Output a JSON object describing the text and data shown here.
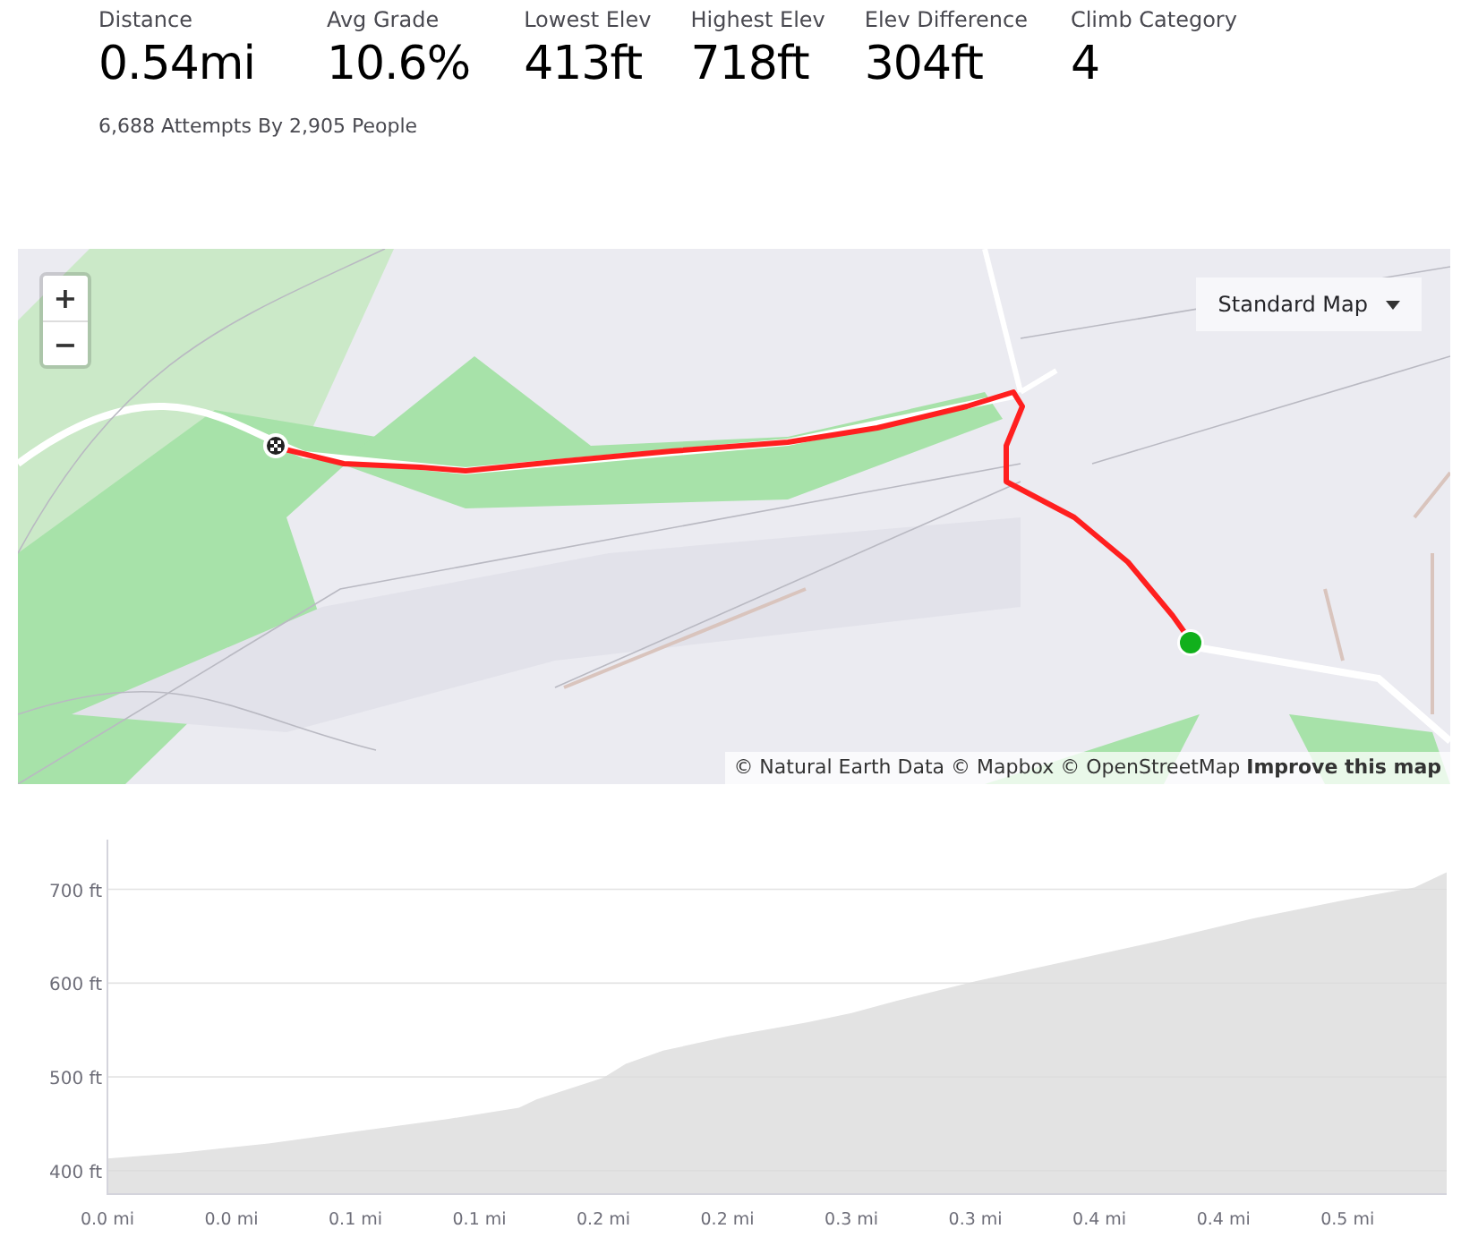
{
  "stats": [
    {
      "label": "Distance",
      "value": "0.54mi"
    },
    {
      "label": "Avg Grade",
      "value": "10.6%"
    },
    {
      "label": "Lowest Elev",
      "value": "413ft"
    },
    {
      "label": "Highest Elev",
      "value": "718ft"
    },
    {
      "label": "Elev Difference",
      "value": "304ft"
    },
    {
      "label": "Climb Category",
      "value": "4"
    }
  ],
  "attempts": "6,688 Attempts By 2,905 People",
  "map": {
    "kind": "picture",
    "zoom_in": "+",
    "zoom_out": "−",
    "style_selector": "Standard Map",
    "attribution": "© Natural Earth Data © Mapbox © OpenStreetMap",
    "attribution_link": "Improve this map"
  },
  "elevation_profile": {
    "chart_data": {
      "type": "area",
      "xlim": [
        0,
        0.54
      ],
      "ylim": [
        375,
        753
      ],
      "xticks": [
        {
          "value": 0,
          "label": "0.0 mi"
        },
        {
          "value": 0.05,
          "label": "0.0 mi"
        },
        {
          "value": 0.1,
          "label": "0.1 mi"
        },
        {
          "value": 0.15,
          "label": "0.1 mi"
        },
        {
          "value": 0.2,
          "label": "0.2 mi"
        },
        {
          "value": 0.25,
          "label": "0.2 mi"
        },
        {
          "value": 0.3,
          "label": "0.3 mi"
        },
        {
          "value": 0.35,
          "label": "0.3 mi"
        },
        {
          "value": 0.4,
          "label": "0.4 mi"
        },
        {
          "value": 0.45,
          "label": "0.4 mi"
        },
        {
          "value": 0.5,
          "label": "0.5 mi"
        }
      ],
      "yticks": [
        {
          "value": 400,
          "label": "400 ft"
        },
        {
          "value": 500,
          "label": "500 ft"
        },
        {
          "value": 600,
          "label": "600 ft"
        },
        {
          "value": 700,
          "label": "700 ft"
        }
      ],
      "x": [
        0,
        0.029,
        0.065,
        0.101,
        0.137,
        0.166,
        0.173,
        0.2,
        0.209,
        0.224,
        0.25,
        0.282,
        0.3,
        0.318,
        0.35,
        0.39,
        0.426,
        0.462,
        0.498,
        0.527,
        0.54
      ],
      "grid": true,
      "series": [
        {
          "color": "#e3e3e3",
          "values": [
            413,
            419,
            429,
            442,
            455,
            467,
            476,
            499,
            514,
            528,
            543,
            558,
            568,
            581,
            602,
            625,
            646,
            669,
            688,
            702,
            718
          ]
        }
      ]
    }
  }
}
